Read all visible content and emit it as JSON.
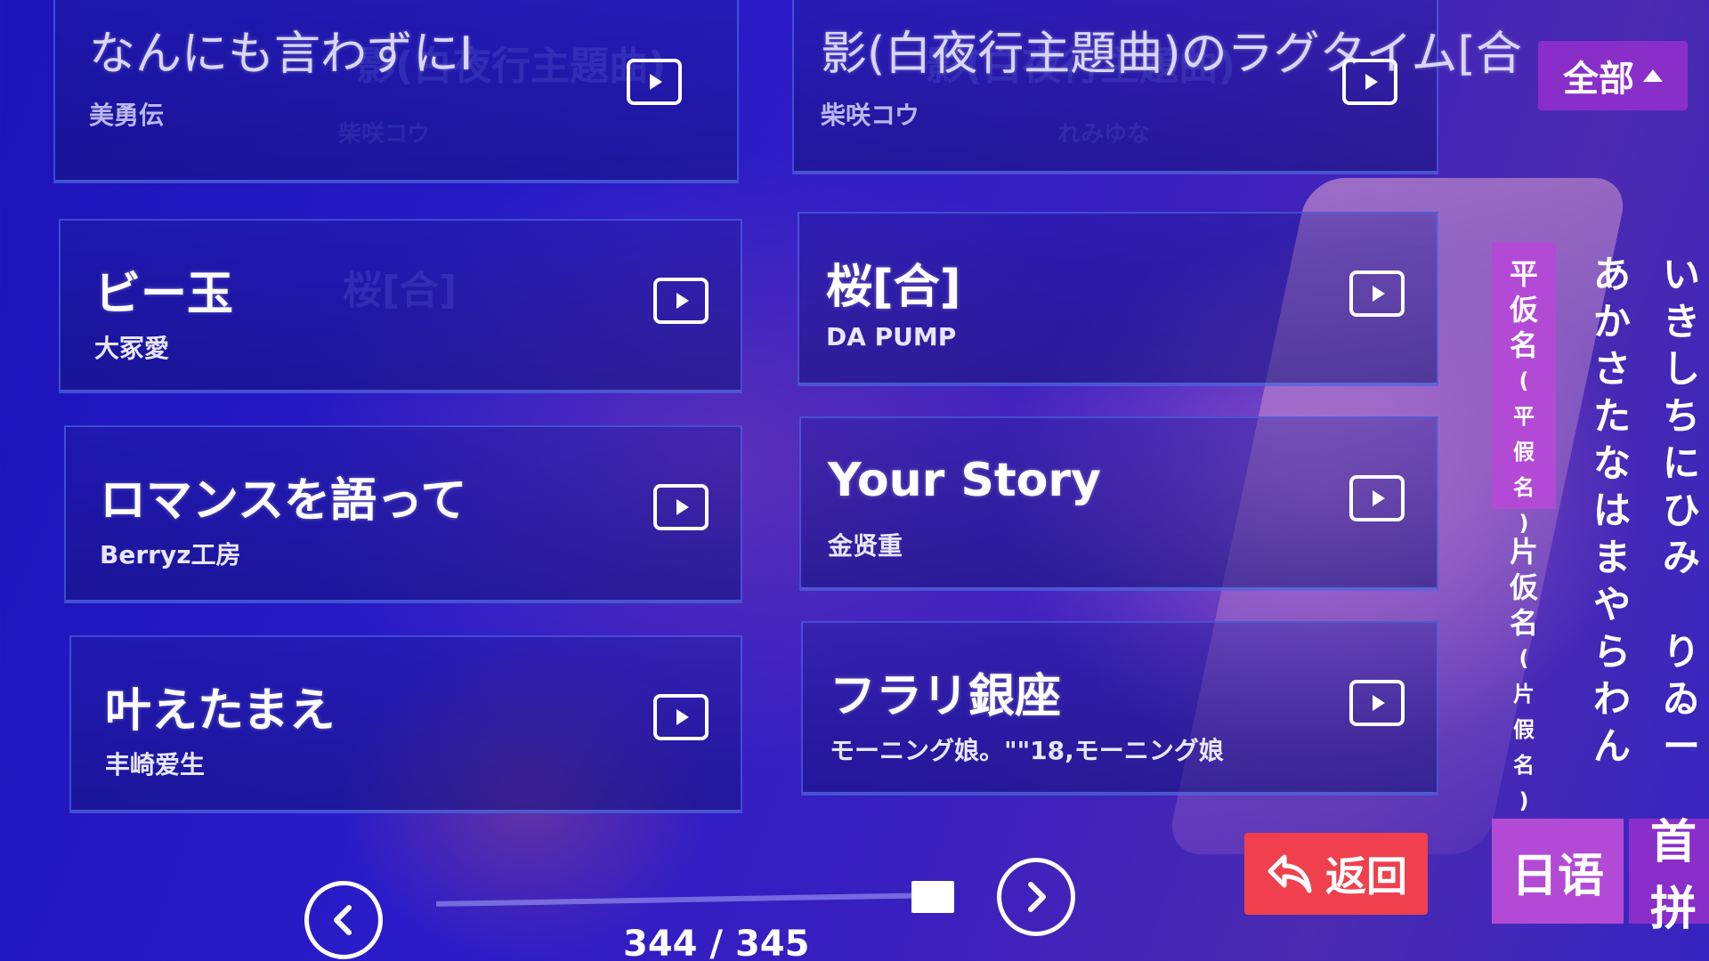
{
  "top_row": [
    {
      "title": "なんにも言わずにI",
      "artist": "美勇伝"
    },
    {
      "title": "影(白夜行主題曲)のラグタイム[合",
      "artist": "柴咲コウ"
    }
  ],
  "ghost_text": {
    "top_left_overlay": "影(白夜行主題曲)",
    "top_left_artist": "柴咲コウ",
    "top_right_overlay": "影(白夜行主題曲)",
    "top_right_artist": "れみゆな",
    "mid_left": "桜[合]"
  },
  "songs": [
    {
      "title": "ビー玉",
      "artist": "大冢愛"
    },
    {
      "title": "桜[合]",
      "artist": "DA PUMP"
    },
    {
      "title": "ロマンスを語って",
      "artist": "Berryz工房"
    },
    {
      "title": "Your Story",
      "artist": "金贤重"
    },
    {
      "title": "叶えたまえ",
      "artist": "丰崎爱生"
    },
    {
      "title": "フラリ銀座",
      "artist": "モーニング娘。\"\"18,モーニング娘"
    }
  ],
  "category_button": {
    "label": "全部"
  },
  "kana_panel": {
    "hiragana_tab": [
      "平",
      "仮",
      "名",
      "(",
      "平",
      "假",
      "名",
      ")"
    ],
    "katakana_tab": [
      "片",
      "仮",
      "名",
      "(",
      "片",
      "假",
      "名",
      ")"
    ],
    "column_a": [
      "あ",
      "か",
      "さ",
      "た",
      "な",
      "は",
      "ま",
      "や",
      "ら",
      "わ",
      "ん"
    ],
    "column_i": [
      "い",
      "き",
      "し",
      "ち",
      "に",
      "ひ",
      "み",
      "",
      "り",
      "ゐ",
      "ー"
    ]
  },
  "pagination": {
    "current": 344,
    "total": 345,
    "text": "344 / 345",
    "progress": 0.997
  },
  "back_button": {
    "label": "返回"
  },
  "language_tabs": [
    {
      "label": "日语",
      "active": true
    },
    {
      "label": "首拼",
      "active": false
    }
  ],
  "icons": {
    "play": "play-icon",
    "prev": "chevron-left-icon",
    "next": "chevron-right-icon",
    "back": "back-arrow-icon",
    "dropdown": "triangle-up-icon"
  },
  "colors": {
    "accent_purple": "#b34ad6",
    "button_purple": "#8a2ec9",
    "back_red": "#f0404d",
    "bg_blue": "#2a1cc8"
  }
}
